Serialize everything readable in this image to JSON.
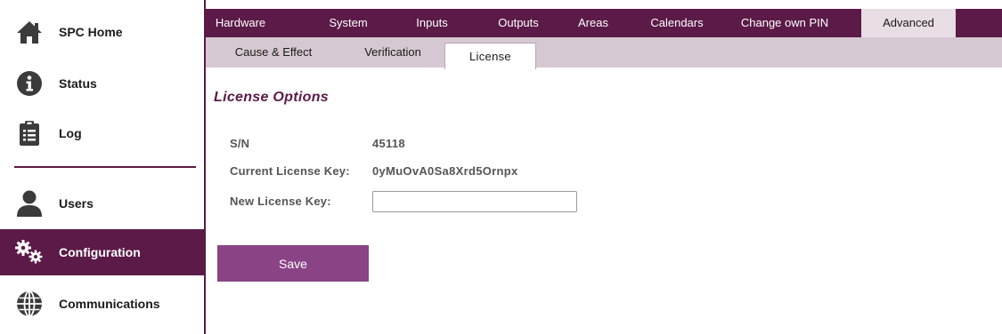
{
  "sidebar": {
    "items": [
      {
        "label": "SPC Home",
        "icon": "home-icon"
      },
      {
        "label": "Status",
        "icon": "info-icon"
      },
      {
        "label": "Log",
        "icon": "clipboard-list-icon"
      },
      {
        "label": "Users",
        "icon": "user-icon"
      },
      {
        "label": "Configuration",
        "icon": "gears-icon",
        "active": true
      },
      {
        "label": "Communications",
        "icon": "globe-icon"
      }
    ]
  },
  "top_tabs": [
    {
      "label": "Hardware"
    },
    {
      "label": "System"
    },
    {
      "label": "Inputs"
    },
    {
      "label": "Outputs"
    },
    {
      "label": "Areas"
    },
    {
      "label": "Calendars"
    },
    {
      "label": "Change own PIN"
    },
    {
      "label": "Advanced",
      "active": true
    }
  ],
  "sub_tabs": [
    {
      "label": "Cause & Effect"
    },
    {
      "label": "Verification"
    },
    {
      "label": "License",
      "active": true
    }
  ],
  "license": {
    "title": "License Options",
    "sn_label": "S/N",
    "sn_value": "45118",
    "current_key_label": "Current License Key:",
    "current_key_value": "0yMuOvA0Sa8Xrd5Ornpx",
    "new_key_label": "New License Key:",
    "new_key_value": "",
    "save_label": "Save"
  },
  "colors": {
    "brand": "#5b1a47",
    "button": "#8a4486",
    "subbar": "#d6c8d2"
  }
}
